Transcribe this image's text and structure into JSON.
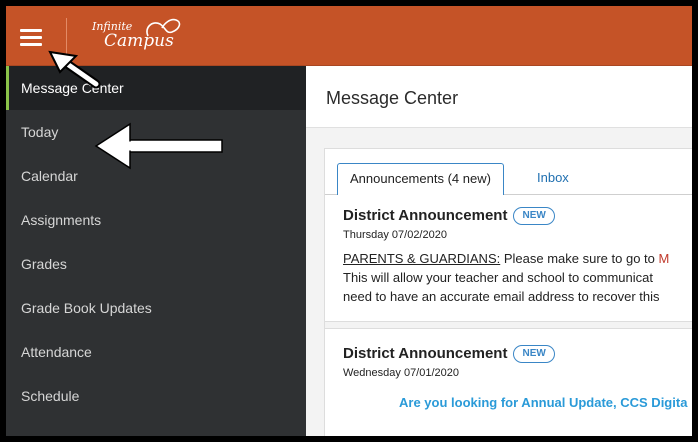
{
  "app": {
    "logo_line1": "Infinite",
    "logo_line2": "Campus"
  },
  "sidebar": {
    "items": [
      {
        "label": "Message Center",
        "active": true
      },
      {
        "label": "Today"
      },
      {
        "label": "Calendar"
      },
      {
        "label": "Assignments"
      },
      {
        "label": "Grades"
      },
      {
        "label": "Grade Book Updates"
      },
      {
        "label": "Attendance"
      },
      {
        "label": "Schedule"
      }
    ]
  },
  "main": {
    "title": "Message Center",
    "tabs": [
      {
        "label": "Announcements (4 new)",
        "active": true
      },
      {
        "label": "Inbox"
      }
    ],
    "announcements": [
      {
        "title": "District Announcement",
        "badge": "NEW",
        "date": "Thursday 07/02/2020",
        "body_underlined": "PARENTS & GUARDIANS:",
        "body_line1_rest": " Please make sure to go to ",
        "body_line1_red": "M",
        "body_line2": "This will allow your teacher and school to communicat",
        "body_line3": "need to have an accurate email address to recover this"
      },
      {
        "title": "District Announcement",
        "badge": "NEW",
        "date": "Wednesday 07/01/2020",
        "link_text": "Are you looking for Annual Update, CCS Digita"
      }
    ]
  },
  "colors": {
    "topbar": "#c55327",
    "sidebar": "#2f3133",
    "active_indicator": "#8bc34a",
    "accent_blue": "#3a86c6",
    "link_blue": "#2a9ad8"
  }
}
